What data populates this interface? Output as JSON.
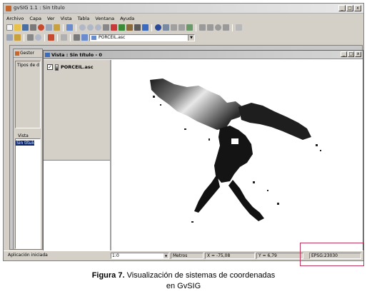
{
  "app": {
    "title": "gvSIG 1.1 : Sin título",
    "minimize": "_",
    "maximize": "□",
    "close": "x"
  },
  "menu": [
    "Archivo",
    "Capa",
    "Ver",
    "Vista",
    "Tabla",
    "Ventana",
    "Ayuda"
  ],
  "toolbar": {
    "layer_selector_value": "PORCEIL.asc",
    "dropdown_symbol": "▼"
  },
  "gestor": {
    "title": "Gestor",
    "doc_types_label": "Tipos de d",
    "group_label": "Vista",
    "list_items": [
      "Sin título"
    ]
  },
  "vista": {
    "title": "Vista : Sin título - 0",
    "minimize": "_",
    "maximize": "□",
    "close": "x",
    "layers": [
      {
        "name": "PORCEIL.asc",
        "visible": true,
        "check_symbol": "✓"
      }
    ]
  },
  "status_bar": {
    "message": "Aplicación iniciada",
    "scale_prefix": "1:",
    "scale_value": "0",
    "units": "Metros",
    "x": "X = -75,08",
    "y": "Y = 6,79",
    "crs": "EPSG:23030"
  },
  "caption": {
    "figure_label": "Figura 7.",
    "text_line1": "Visualización de sistemas de coordenadas",
    "text_line2": "en GvSIG"
  },
  "colors": {
    "window_bg": "#d4d0c8",
    "selection": "#0a246a",
    "highlight_frame": "#c0365a"
  }
}
